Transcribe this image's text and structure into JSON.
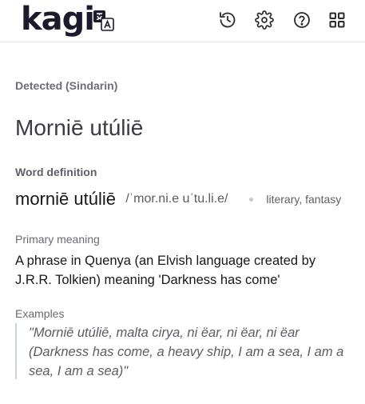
{
  "header": {
    "logo_text": "kagi",
    "icons": [
      "translate-icon",
      "history-icon",
      "settings-icon",
      "help-icon",
      "apps-icon"
    ]
  },
  "detection": {
    "label": "Detected (Sindarin)",
    "source_text": "Morniē utúliē"
  },
  "word_definition": {
    "label": "Word definition",
    "word": "morniē utúliē",
    "pronunciation": "/ˈmor.ni.e uˈtu.li.e/",
    "tags": "literary, fantasy"
  },
  "primary_meaning": {
    "label": "Primary meaning",
    "text": "A phrase in Quenya (an Elvish language created by J.R.R. Tolkien) meaning 'Darkness has come'"
  },
  "examples": {
    "label": "Examples",
    "text": "\"Morniē utúliē, malta cirya, ni ëar, ni ëar, ni ëar (Darkness has come, a heavy ship, I am a sea, I am a sea, I am a sea)\""
  },
  "colors": {
    "brand": "#1d1b2b",
    "quote_border": "#c8d2ea"
  }
}
